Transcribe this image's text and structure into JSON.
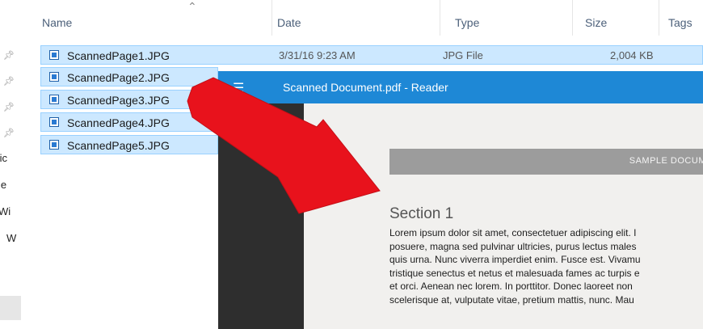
{
  "explorer": {
    "columns": [
      "Name",
      "Date",
      "Type",
      "Size",
      "Tags"
    ],
    "nav_fragments": [
      "fic",
      "le",
      "Wi",
      "W"
    ],
    "files": [
      {
        "name": "ScannedPage1.JPG",
        "date": "3/31/16 9:23 AM",
        "type": "JPG File",
        "size": "2,004 KB"
      },
      {
        "name": "ScannedPage2.JPG"
      },
      {
        "name": "ScannedPage3.JPG"
      },
      {
        "name": "ScannedPage4.JPG"
      },
      {
        "name": "ScannedPage5.JPG"
      }
    ]
  },
  "reader": {
    "title": "Scanned Document.pdf - Reader",
    "banner": "SAMPLE DOCUM",
    "section_title": "Section 1",
    "paragraph": [
      "Lorem ipsum dolor sit amet, consectetuer adipiscing elit. I",
      "posuere, magna sed pulvinar ultricies, purus lectus males",
      "quis urna. Nunc viverra imperdiet enim. Fusce est. Vivamu",
      "tristique senectus et netus et malesuada fames ac turpis e",
      "et orci. Aenean nec lorem. In porttitor. Donec laoreet non",
      "scelerisque at, vulputate vitae, pretium mattis, nunc. Mau"
    ]
  },
  "colors": {
    "selection": "#cce8ff",
    "reader_bar": "#1e88d6",
    "arrow": "#e8121c"
  }
}
